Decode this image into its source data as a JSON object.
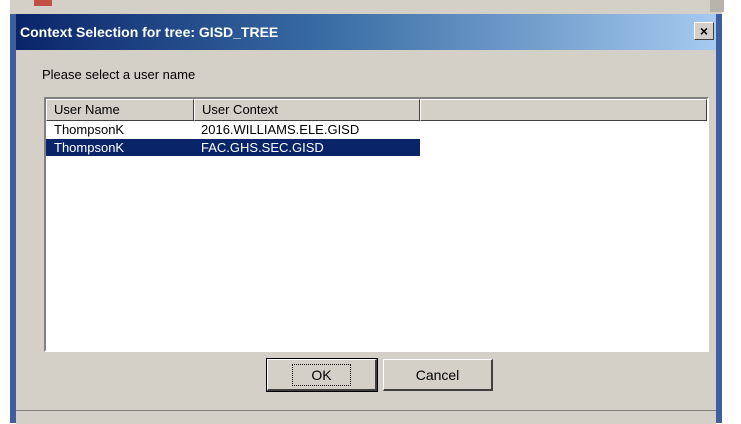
{
  "dialog": {
    "title": "Context Selection for tree: GISD_TREE",
    "close_glyph": "×",
    "prompt": "Please select a user name",
    "columns": [
      "User Name",
      "User Context",
      ""
    ],
    "rows": [
      {
        "user_name": "ThompsonK",
        "user_context": "2016.WILLIAMS.ELE.GISD",
        "selected": false
      },
      {
        "user_name": "ThompsonK",
        "user_context": "FAC.GHS.SEC.GISD",
        "selected": true
      }
    ],
    "ok_label": "OK",
    "cancel_label": "Cancel"
  },
  "colors": {
    "title_bar_start": "#0a246a",
    "title_bar_end": "#a6caf0",
    "selection": "#0a246a",
    "dialog_face": "#d4d0c8"
  }
}
